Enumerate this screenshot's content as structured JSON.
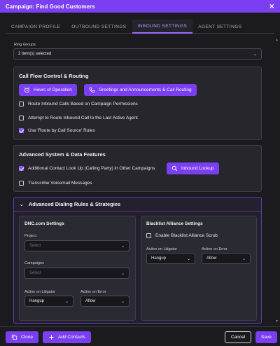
{
  "window": {
    "title": "Campaign: Find Good Customers",
    "close_glyph": "✕"
  },
  "tabs": [
    {
      "label": "CAMPAIGN PROFILE",
      "active": false
    },
    {
      "label": "OUTBOUND SETTINGS",
      "active": false
    },
    {
      "label": "INBOUND SETTINGS",
      "active": true
    },
    {
      "label": "AGENT SETTINGS",
      "active": false
    }
  ],
  "ring_groups": {
    "label": "Ring Groups",
    "value": "2 item(s) selected"
  },
  "call_flow": {
    "title": "Call Flow Control & Routing",
    "hours_button": "Hours of Operation",
    "greetings_button": "Greetings and Announcements & Call Routing",
    "options": [
      {
        "label": "Route Inbound Calls Based on Campaign Permissions",
        "checked": false
      },
      {
        "label": "Attempt to Route Inbound Call to the Last Active Agent",
        "checked": false
      },
      {
        "label": "Use 'Route by Call Source' Rules",
        "checked": true
      }
    ]
  },
  "advanced_system": {
    "title": "Advanced System & Data Features",
    "lookup_option": {
      "label": "Additional Contact Look Up (Calling Party) in Other Campaigns",
      "checked": true
    },
    "lookup_button": "Inbound Lookup",
    "transcribe_option": {
      "label": "Transcribe Voicemail Messages",
      "checked": false
    }
  },
  "advanced_dialing": {
    "title": "Advanced Dialing Rules & Strategies",
    "dnc": {
      "title": "DNC.com Settings",
      "project_label": "Project",
      "project_placeholder": "Select",
      "campaigns_label": "Campaigns",
      "campaigns_placeholder": "Select",
      "litigator_label": "Action on Litigator",
      "litigator_value": "Hangup",
      "error_label": "Action on Error",
      "error_value": "Allow"
    },
    "blacklist": {
      "title": "Blacklist Alliance Settings",
      "enable_label": "Enable Blacklist Alliance Scrub",
      "enable_checked": false,
      "litigator_label": "Action on Litigator",
      "litigator_value": "Hangup",
      "error_label": "Action on Error",
      "error_value": "Allow"
    }
  },
  "footer": {
    "clone": "Clone",
    "add_contacts": "Add Contacts",
    "cancel": "Cancel",
    "save": "Save"
  },
  "colors": {
    "accent": "#7b3ff2",
    "background": "#1b1b1f",
    "panel": "#26262c"
  }
}
